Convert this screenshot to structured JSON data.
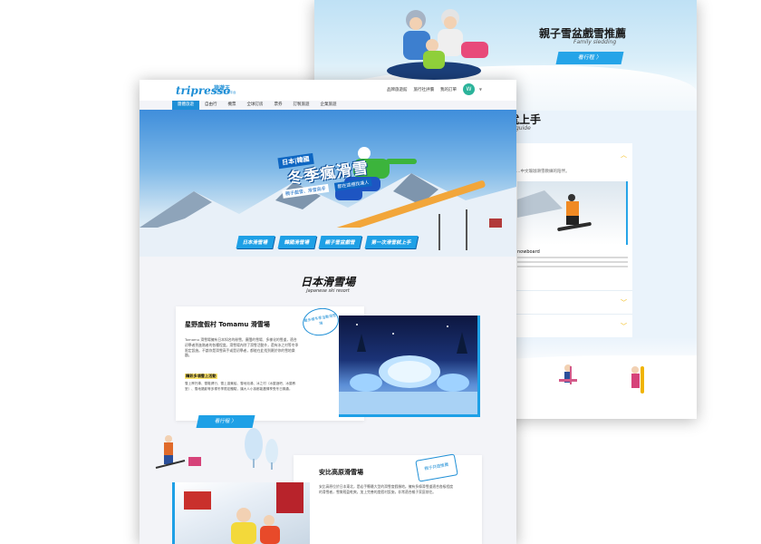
{
  "back_page": {
    "hero_title": "親子雪盆戲雪推薦",
    "hero_subtitle": "Family sledding",
    "hero_button": "看行程 〉",
    "section_title_fragment": "就上手",
    "section_subtitle_fragment": "guide",
    "card_text_fragment": "…中文瑜珈滑雪教練的陪伴。",
    "snowboard_title_fragment": "nowboard",
    "accordion_icon": "chevron-down-icon"
  },
  "front_page": {
    "logo": {
      "brand": "tripresso",
      "brand_cn": "旅遊王",
      "tagline": "旅行社比價平台"
    },
    "top_links": [
      "品牌旅遊館",
      "旅行社評價",
      "我的訂單"
    ],
    "avatar_letter": "W",
    "nav": [
      "團體旅遊",
      "自由行",
      "機票",
      "全球訂房",
      "票券",
      "訂製旅遊",
      "企業旅遊"
    ],
    "nav_active_index": 0,
    "hero": {
      "tag": "日本|韓國",
      "title": "冬季瘋滑雪",
      "slogan_a": "親子戲雪、滑雪高手",
      "slogan_b": "都在這裡找達人",
      "chips": [
        "日本滑雪場",
        "韓國滑雪場",
        "親子雪盆戲雪",
        "第一次滑雪就上手"
      ]
    },
    "section_title": "日本滑雪場",
    "section_subtitle": "Japanese ski resort",
    "resort1": {
      "title": "星野度假村 Tomamu 滑雪場",
      "desc": "Tomamu 滑雪場擁有日本知名的粉雪，廣闊的雪場、多樣化的雪道，適合初學者到進階者的各種程度。滑雪場內除了滑雪活動外，還有冰之村等冬季限定設施。不論你是滑雪高手或是初學者，都能在此找到屬於你的雪地樂趣。",
      "label": "精彩多項雪上活動",
      "bullets": "雪上摩托車、雪鞋健行、雪上香蕉船、雪地泡湯、冰之村（冰屋酒吧、冰屋教堂）、雪地攝影等多樣冬季限定體驗，讓大人小孩都能盡情享受冬日樂趣。",
      "stamp": "最多樣冬季活動滑雪場",
      "button": "看行程 〉"
    },
    "resort2": {
      "title": "安比高原滑雪場",
      "desc": "安比高原位於日本東北，是岩手縣最大型的滑雪度假勝地。擁有多條滑雪道適合各級程度的滑雪者，雪質輕盈乾爽，加上完善的度假村設施，非常適合親子家庭前往。",
      "stamp": "親子共遊推薦"
    },
    "colors": {
      "accent": "#1ea0e6",
      "nav_active": "#1f8fd6",
      "highlight": "#ffe66b"
    }
  }
}
